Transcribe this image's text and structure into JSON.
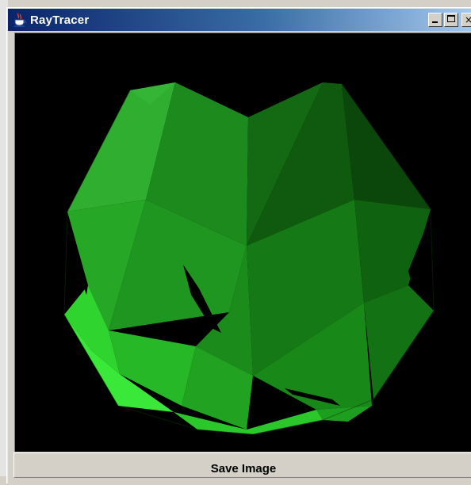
{
  "window": {
    "title": "RayTracer",
    "app_icon": "java-cup-icon",
    "controls": {
      "minimize": "minimize-icon",
      "maximize": "maximize-icon",
      "close": "close-icon",
      "close_glyph": "×"
    }
  },
  "render": {
    "background_color": "#000000",
    "object_color": "#00c800",
    "description_icon": "rendered-green-polyhedron"
  },
  "actions": {
    "save_label": "Save Image"
  },
  "colors": {
    "titlebar_start": "#0a246a",
    "titlebar_end": "#a6caf0",
    "chrome": "#d4d0c8"
  }
}
